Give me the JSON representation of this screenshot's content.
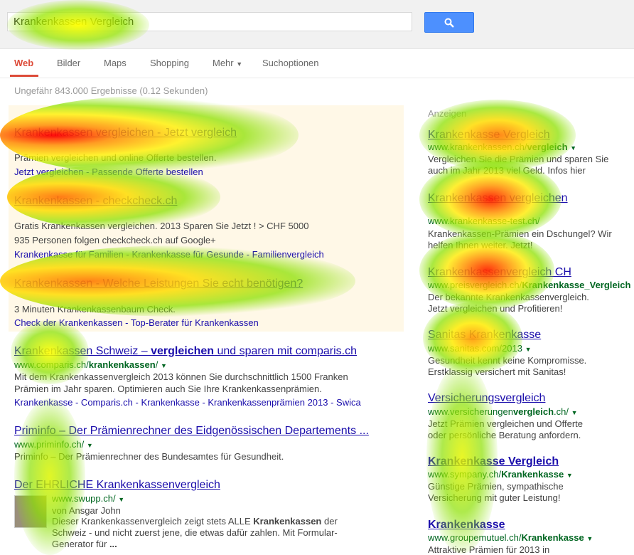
{
  "search": {
    "query": "Krankenkassen Vergleich"
  },
  "nav": {
    "tabs": [
      "Web",
      "Bilder",
      "Maps",
      "Shopping",
      "Mehr"
    ],
    "options": "Suchoptionen"
  },
  "stats": "Ungefähr 843.000 Ergebnisse (0.12 Sekunden)",
  "ads": [
    {
      "title": "Krankenkassen vergleichen - Jetzt vergleich",
      "snippet": "Prämien vergleichen und online Offerte bestellen.",
      "links": "Jetzt vergleichen - Passende Offerte bestellen"
    },
    {
      "title": "Krankenkassen - checkcheck.ch",
      "snippet": "Gratis Krankenkassen vergleichen. 2013 Sparen Sie Jetzt ! > CHF 5000",
      "social": "935 Personen folgen checkcheck.ch auf Google+",
      "links_a": "Krankenkasse für Familien - Krankenkasse für Gesunde -",
      "links_b": "Familienvergleich"
    },
    {
      "title": "Krankenkassen - Welche Leistungen Sie echt benötigen?",
      "snippet": "3 Minuten Krankenkassenbaum Check.",
      "links_a": "Check der Krankenkassen -",
      "links_b": "Top-Berater für Krankenkassen"
    }
  ],
  "results": [
    {
      "title_a": "Krankenkassen Schweiz – ",
      "title_b": "vergleichen",
      "title_c": " und sparen mit comparis.ch",
      "url_a": "www.comparis.ch/",
      "url_b": "krankenkassen",
      "url_c": "/",
      "snippet_1": "Mit dem Krankenkassenvergleich 2013 können Sie durchschnittlich 1500 Franken",
      "snippet_2": "Prämien im Jahr sparen. Optimieren auch Sie Ihre Krankenkassenprämien.",
      "links": "Krankenkasse - Comparis.ch - Krankenkasse - Krankenkassenprämien 2013 - Swica"
    },
    {
      "title": "Priminfo – Der Prämienrechner des Eidgenössischen Departements ...",
      "url": "www.priminfo.ch/",
      "snippet": "Priminfo – Der Prämienrechner des Bundesamtes für Gesundheit."
    },
    {
      "title": "Der EHRLICHE Krankenkassenvergleich",
      "url": "www.swupp.ch/",
      "author": "von Ansgar John",
      "snippet_1a": "Dieser Krankenkassenvergleich zeigt stets ALLE ",
      "snippet_1b": "Krankenkassen",
      "snippet_1c": " der",
      "snippet_2": "Schweiz - und nicht zuerst jene, die etwas dafür zahlen. Mit Formular-",
      "snippet_3a": "Generator für ",
      "snippet_3b": "..."
    }
  ],
  "right_header": "Anzeigen",
  "right_ads": [
    {
      "title": "Krankenkasse Vergleich",
      "url_a": "www.krankenkassen.ch/",
      "url_b": "vergleich",
      "snippet_1": "Vergleichen Sie die Prämien und sparen Sie",
      "snippet_2": "auch im Jahr 2013 viel Geld. Infos hier"
    },
    {
      "title": "Krankenkassen vergleichen",
      "url": "www.krankenkasse-test.ch/",
      "snippet_1": "Krankenkassen-Prämien ein Dschungel? Wir",
      "snippet_2": "helfen Ihnen weiter. Jetzt!"
    },
    {
      "title": "Krankenkassenvergleich CH",
      "url_a": "www.preisvergleich.ch/",
      "url_b": "Krankenkasse_Vergleich",
      "snippet_1": "Der bekannte Krankenkassenvergleich.",
      "snippet_2": "Jetzt vergleichen und Profitieren!"
    },
    {
      "title": "Sanitas Krankenkasse",
      "url": "www.sanitas.com/2013",
      "snippet_1": "Gesundheit kennt keine Kompromisse.",
      "snippet_2": "Erstklassig versichert mit Sanitas!"
    },
    {
      "title": "Versicherungsvergleich",
      "url_a": "www.versicherungen",
      "url_b": "vergleich",
      "url_c": ".ch/",
      "snippet_1": "Jetzt Prämien vergleichen und Offerte",
      "snippet_2": "oder persönliche Beratung anfordern."
    },
    {
      "title": "Krankenkasse Vergleich",
      "url_a": "www.sympany.ch/",
      "url_b": "Krankenkasse",
      "snippet_1": "Günstige Prämien, sympathische",
      "snippet_2": "Versicherung mit guter Leistung!"
    },
    {
      "title": "Krankenkasse",
      "url_a": "www.groupemutuel.ch/",
      "url_b": "Krankenkasse",
      "snippet_1": "Attraktive Prämien für 2013 in"
    }
  ]
}
